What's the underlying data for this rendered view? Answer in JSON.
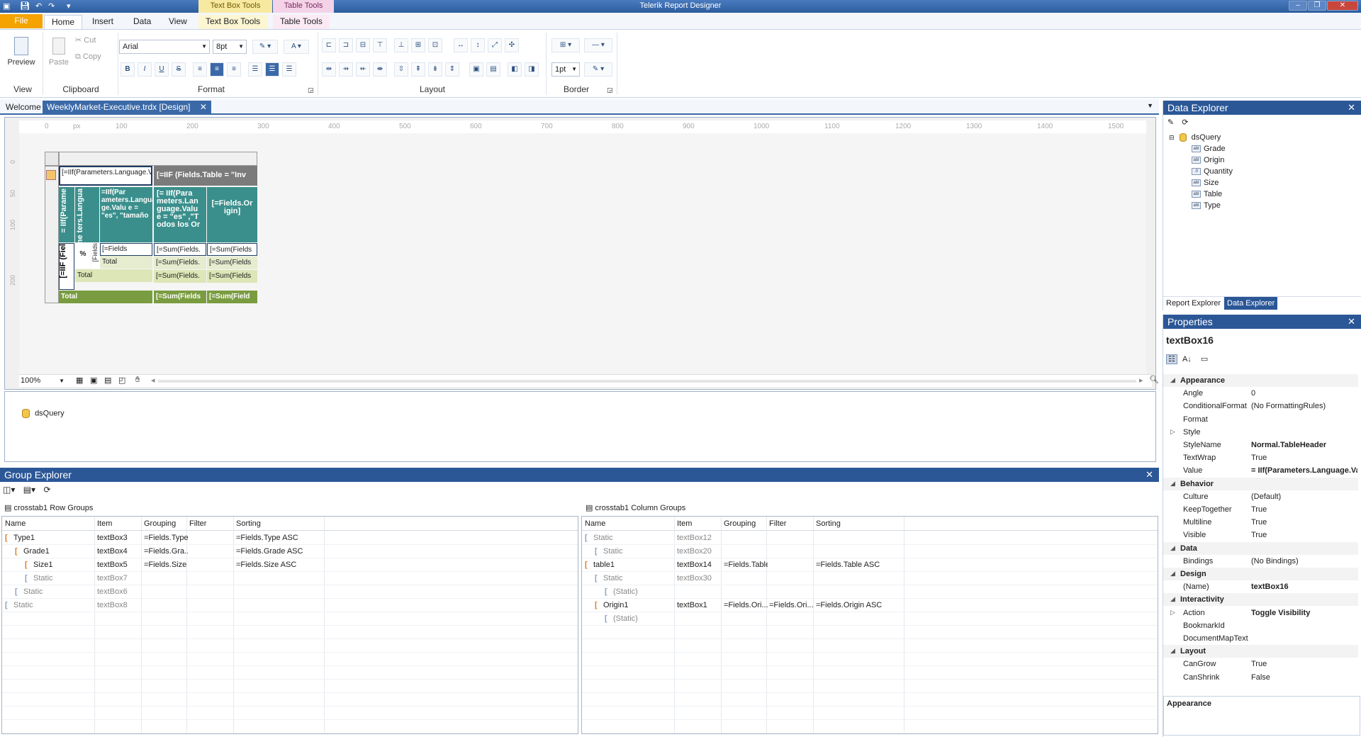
{
  "window": {
    "title": "Telerik Report Designer",
    "context_tabs": [
      "Text Box Tools",
      "Table Tools"
    ]
  },
  "ribbon": {
    "tabs": [
      "File",
      "Home",
      "Insert",
      "Data",
      "View",
      "Text Box Tools",
      "Table Tools"
    ],
    "view": {
      "preview": "Preview",
      "label": "View"
    },
    "clipboard": {
      "paste": "Paste",
      "cut": "Cut",
      "copy": "Copy",
      "label": "Clipboard"
    },
    "format": {
      "font": "Arial",
      "size": "8pt",
      "label": "Format"
    },
    "layout": {
      "label": "Layout"
    },
    "border": {
      "width": "1pt",
      "label": "Border"
    }
  },
  "doc_tabs": [
    "Welcome",
    "WeeklyMarket-Executive.trdx [Design]"
  ],
  "ruler": {
    "unit": "px",
    "marks": [
      "0",
      "100",
      "200",
      "300",
      "400",
      "500",
      "600",
      "700",
      "800",
      "900",
      "1000",
      "1100",
      "1200",
      "1300",
      "1400",
      "1500"
    ],
    "vmarks": [
      "0",
      "50",
      "100",
      "200"
    ]
  },
  "crosstab": {
    "header_top": "[=IIf(Parameters.Language.Value=\"es\",\"E",
    "header_table": "[=IIF (Fields.Table = \"Inv",
    "v1": "= IIf(Parame",
    "v2": "= IIf(Parame ters.Langua",
    "v3": "=IIf(Par ameters.Langua ge.Valu e = \"es\", \"tamaño",
    "param_col": "[= IIf(Para meters.Lan guage.Valu e = \"es\" ,\"T odos los Or",
    "origin_col": "[=Fields.Or igin]",
    "v_type": "[=IIF (Fiel",
    "pct": "%",
    "fields_v": "[Fields",
    "fields_cell": "[=Fields",
    "total": "Total",
    "sum1": "[=Sum(Fields.",
    "sum2": "[=Sum(Fields",
    "sum3": "[=Sum(Fields.",
    "sum4": "[=Sum(Fields",
    "sum5": "[=Sum(Fields.",
    "sum6": "[=Sum(Fields",
    "sum7": "[=Sum(Fields",
    "sum8": "[=Sum(Field"
  },
  "zoom": "100%",
  "tray": {
    "ds": "dsQuery"
  },
  "group_explorer": {
    "title": "Group Explorer",
    "row_title": "crosstab1 Row Groups",
    "col_title": "crosstab1 Column Groups",
    "headers": [
      "Name",
      "Item",
      "Grouping",
      "Filter",
      "Sorting"
    ],
    "row_groups": [
      {
        "name": "Type1",
        "item": "textBox3",
        "grouping": "=Fields.Type",
        "filter": "",
        "sorting": "=Fields.Type ASC",
        "static": false,
        "level": 0
      },
      {
        "name": "Grade1",
        "item": "textBox4",
        "grouping": "=Fields.Gra...",
        "filter": "",
        "sorting": "=Fields.Grade ASC",
        "static": false,
        "level": 1
      },
      {
        "name": "Size1",
        "item": "textBox5",
        "grouping": "=Fields.Size",
        "filter": "",
        "sorting": "=Fields.Size ASC",
        "static": false,
        "level": 2
      },
      {
        "name": "Static",
        "item": "textBox7",
        "grouping": "",
        "filter": "",
        "sorting": "",
        "static": true,
        "level": 2
      },
      {
        "name": "Static",
        "item": "textBox6",
        "grouping": "",
        "filter": "",
        "sorting": "",
        "static": true,
        "level": 1
      },
      {
        "name": "Static",
        "item": "textBox8",
        "grouping": "",
        "filter": "",
        "sorting": "",
        "static": true,
        "level": 0
      }
    ],
    "col_groups": [
      {
        "name": "Static",
        "item": "textBox12",
        "grouping": "",
        "filter": "",
        "sorting": "",
        "static": true,
        "level": 0
      },
      {
        "name": "Static",
        "item": "textBox20",
        "grouping": "",
        "filter": "",
        "sorting": "",
        "static": true,
        "level": 1
      },
      {
        "name": "table1",
        "item": "textBox14",
        "grouping": "=Fields.Table",
        "filter": "",
        "sorting": "=Fields.Table ASC",
        "static": false,
        "level": 0
      },
      {
        "name": "Static",
        "item": "textBox30",
        "grouping": "",
        "filter": "",
        "sorting": "",
        "static": true,
        "level": 1
      },
      {
        "name": "(Static)",
        "item": "",
        "grouping": "",
        "filter": "",
        "sorting": "",
        "static": true,
        "level": 2
      },
      {
        "name": "Origin1",
        "item": "textBox1",
        "grouping": "=Fields.Ori...",
        "filter": "=Fields.Ori...",
        "sorting": "=Fields.Origin ASC",
        "static": false,
        "level": 1
      },
      {
        "name": "(Static)",
        "item": "",
        "grouping": "",
        "filter": "",
        "sorting": "",
        "static": true,
        "level": 2
      }
    ]
  },
  "data_explorer": {
    "title": "Data Explorer",
    "root": "dsQuery",
    "fields": [
      {
        "name": "Grade",
        "icon": "abl"
      },
      {
        "name": "Origin",
        "icon": "abl"
      },
      {
        "name": "Quantity",
        "icon": ".0"
      },
      {
        "name": "Size",
        "icon": "abl"
      },
      {
        "name": "Table",
        "icon": "abl"
      },
      {
        "name": "Type",
        "icon": "abl"
      }
    ],
    "tabs": [
      "Report Explorer",
      "Data Explorer"
    ]
  },
  "properties": {
    "title": "Properties",
    "object": "textBox16",
    "rows": [
      {
        "cat": true,
        "name": "Appearance"
      },
      {
        "name": "Angle",
        "value": "0"
      },
      {
        "name": "ConditionalFormat",
        "value": "(No FormattingRules)"
      },
      {
        "name": "Format",
        "value": ""
      },
      {
        "name": "Style",
        "value": "",
        "expand": true
      },
      {
        "name": "StyleName",
        "value": "Normal.TableHeader",
        "bold": true
      },
      {
        "name": "TextWrap",
        "value": "True"
      },
      {
        "name": "Value",
        "value": "= IIf(Parameters.Language.Va",
        "bold": true
      },
      {
        "cat": true,
        "name": "Behavior"
      },
      {
        "name": "Culture",
        "value": "(Default)"
      },
      {
        "name": "KeepTogether",
        "value": "True"
      },
      {
        "name": "Multiline",
        "value": "True"
      },
      {
        "name": "Visible",
        "value": "True"
      },
      {
        "cat": true,
        "name": "Data"
      },
      {
        "name": "Bindings",
        "value": "(No Bindings)"
      },
      {
        "cat": true,
        "name": "Design"
      },
      {
        "name": "(Name)",
        "value": "textBox16",
        "bold": true
      },
      {
        "cat": true,
        "name": "Interactivity"
      },
      {
        "name": "Action",
        "value": "Toggle Visibility",
        "bold": true,
        "expand": true
      },
      {
        "name": "BookmarkId",
        "value": ""
      },
      {
        "name": "DocumentMapText",
        "value": ""
      },
      {
        "cat": true,
        "name": "Layout"
      },
      {
        "name": "CanGrow",
        "value": "True"
      },
      {
        "name": "CanShrink",
        "value": "False"
      }
    ],
    "desc_title": "Appearance"
  }
}
